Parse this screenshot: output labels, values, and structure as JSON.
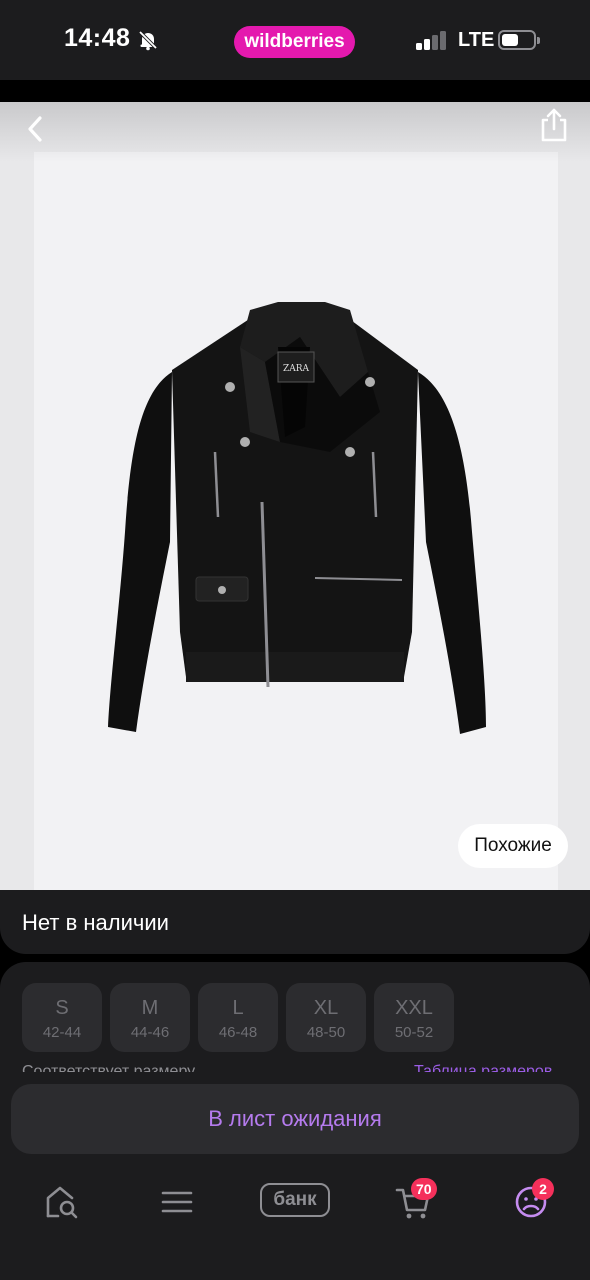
{
  "status_bar": {
    "time": "14:48",
    "brand": "wildberries",
    "network": "LTE",
    "brand_color": "#e419ae"
  },
  "product": {
    "image_alt": "black leather biker jacket",
    "logo_text": "ZARA",
    "similar_label": "Похожие"
  },
  "availability": {
    "text": "Нет в наличии"
  },
  "sizes": [
    {
      "size": "S",
      "ru": "42-44"
    },
    {
      "size": "M",
      "ru": "44-46"
    },
    {
      "size": "L",
      "ru": "46-48"
    },
    {
      "size": "XL",
      "ru": "48-50"
    },
    {
      "size": "XXL",
      "ru": "50-52"
    }
  ],
  "size_fit_text": "Соответствует размеру",
  "size_table_link": "Таблица размеров",
  "wait_button": {
    "label": "В лист ожидания",
    "color": "#b57bee"
  },
  "bottom_nav": {
    "items": [
      "home-search-icon",
      "menu-icon",
      "bank",
      "cart-icon",
      "profile-icon"
    ],
    "bank_label": "банк",
    "cart_badge": "70",
    "profile_badge": "2",
    "badge_color": "#f5305b"
  }
}
